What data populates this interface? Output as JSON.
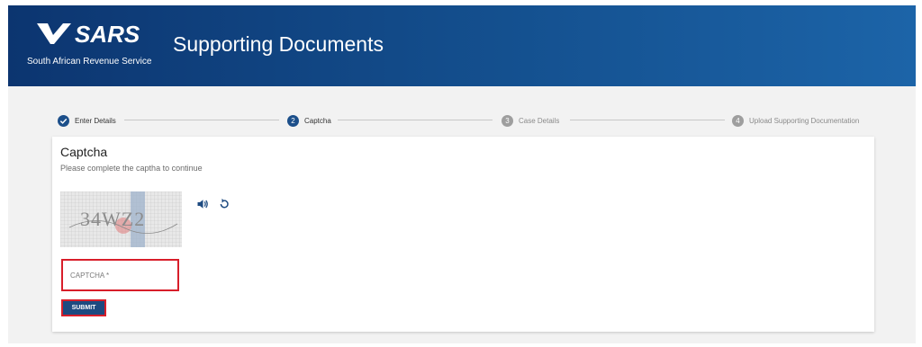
{
  "header": {
    "logo_text": "SARS",
    "logo_subtitle": "South African Revenue Service",
    "title": "Supporting Documents",
    "brand_colors": [
      "#0c3570",
      "#1c64a8"
    ]
  },
  "stepper": {
    "steps": [
      {
        "number": "✓",
        "label": "Enter Details",
        "state": "completed",
        "icon": "check-icon"
      },
      {
        "number": "2",
        "label": "Captcha",
        "state": "active"
      },
      {
        "number": "3",
        "label": "Case Details",
        "state": "pending"
      },
      {
        "number": "4",
        "label": "Upload Supporting Documentation",
        "state": "pending"
      }
    ]
  },
  "card": {
    "title": "Captcha",
    "subtitle": "Please complete the captha to continue",
    "captcha_text": "34WZ2",
    "audio_icon": "speaker-icon",
    "refresh_icon": "refresh-icon",
    "captcha_placeholder": "CAPTCHA *",
    "captcha_value": "",
    "submit_label": "SUBMIT",
    "highlight_color": "#d81e2a"
  }
}
